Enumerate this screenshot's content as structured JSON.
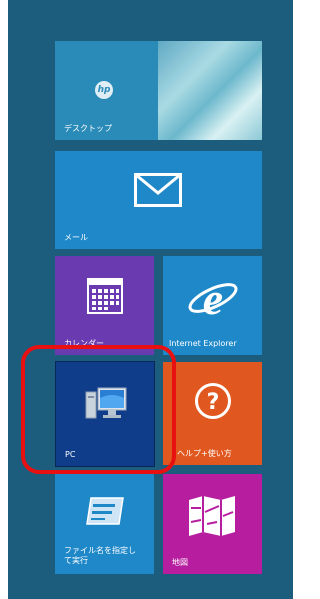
{
  "tiles": {
    "desktop": {
      "label": "デスクトップ",
      "logo_text": "hp"
    },
    "mail": {
      "label": "メール"
    },
    "calendar": {
      "label": "カレンダー"
    },
    "ie": {
      "label": "Internet Explorer"
    },
    "pc": {
      "label": "PC"
    },
    "help": {
      "label": "ヘルプ+使い方"
    },
    "run": {
      "label": "ファイル名を指定して実行"
    },
    "maps": {
      "label": "地図"
    }
  },
  "colors": {
    "background": "#1c5d7d",
    "highlight": "#e81010",
    "mail": "#1f88c9",
    "calendar": "#6a3ab0",
    "pc": "#0f3d8a",
    "help": "#e0581f",
    "maps": "#b71e9f"
  },
  "icons": {
    "mail": "envelope-icon",
    "calendar": "calendar-grid-icon",
    "ie": "internet-explorer-icon",
    "pc": "computer-icon",
    "help": "question-mark-icon",
    "run": "run-dialog-icon",
    "maps": "map-icon"
  }
}
